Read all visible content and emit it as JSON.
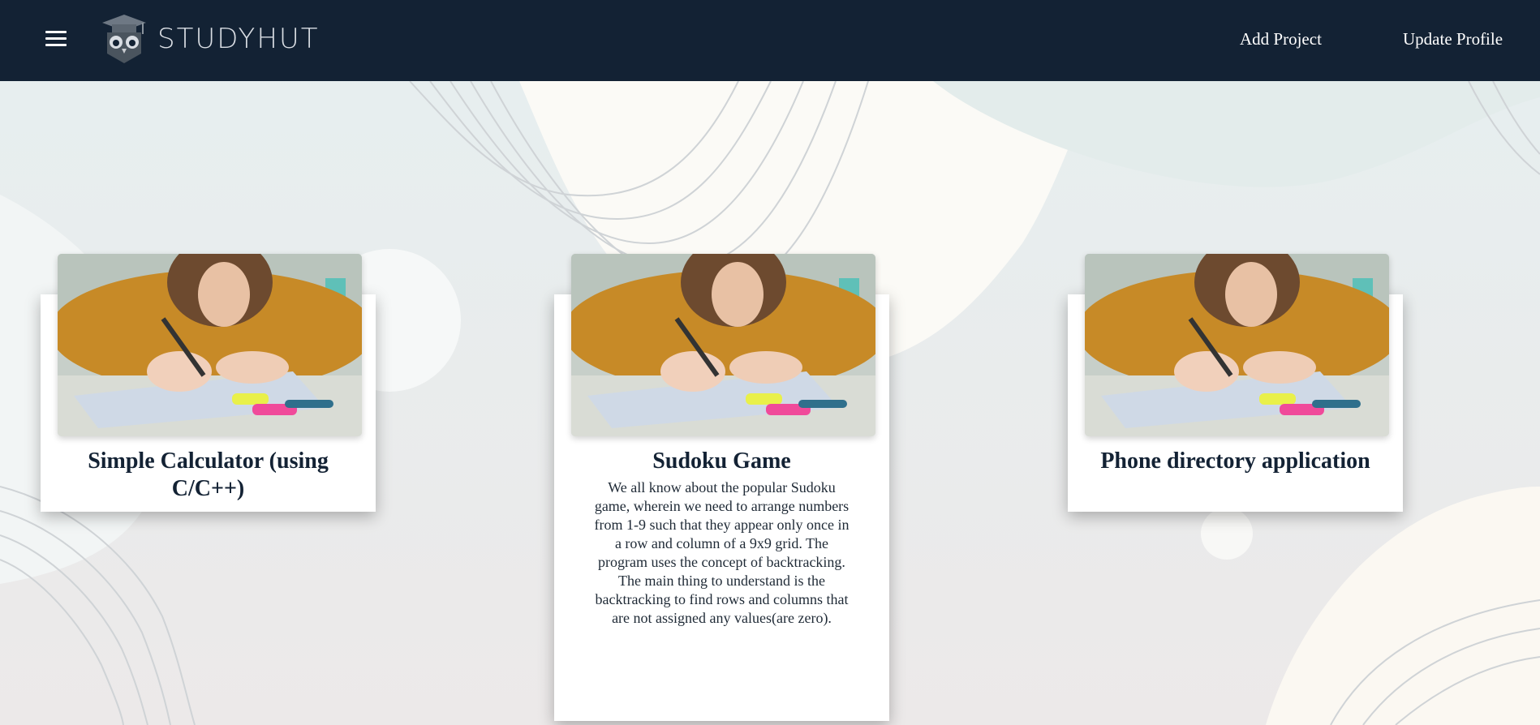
{
  "header": {
    "menu_icon": "hamburger-menu-icon",
    "logo_icon": "owl-graduation-cap-icon",
    "logo_text": "STUDYHUT",
    "nav": [
      {
        "label": "Add Project"
      },
      {
        "label": "Update Profile"
      }
    ]
  },
  "projects": [
    {
      "title": "Simple Calculator (using C/C++)",
      "description": ""
    },
    {
      "title": "Sudoku Game",
      "description": "We all know about the popular Sudoku game, wherein we need to arrange numbers from 1-9 such that they appear only once in a row and column of a 9x9 grid. The program uses the concept of backtracking. The main thing to understand is the backtracking to find rows and columns that are not assigned any values(are zero)."
    },
    {
      "title": "Phone directory application",
      "description": ""
    }
  ],
  "colors": {
    "header_bg": "#132234",
    "card_bg": "#ffffff",
    "title_text": "#132234"
  }
}
